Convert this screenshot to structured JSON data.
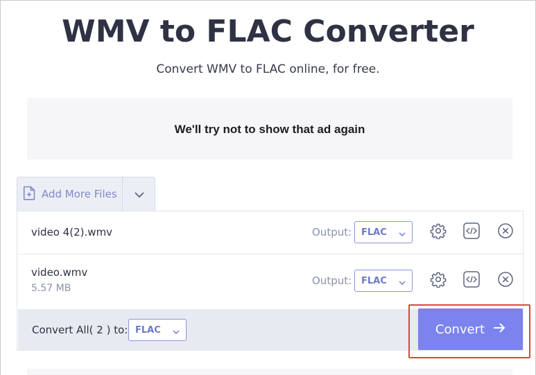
{
  "page": {
    "title": "WMV to FLAC Converter",
    "subtitle": "Convert WMV to FLAC online, for free."
  },
  "ad": {
    "text": "We'll try not to show that ad again"
  },
  "uploader": {
    "add_label": "Add More Files"
  },
  "files": [
    {
      "name": "video 4(2).wmv",
      "size": "",
      "output_label": "Output:",
      "format": "FLAC"
    },
    {
      "name": "video.wmv",
      "size": "5.57 MB",
      "output_label": "Output:",
      "format": "FLAC"
    }
  ],
  "footer": {
    "convert_all_label": "Convert All( 2 ) to:",
    "convert_all_format": "FLAC",
    "convert_label": "Convert"
  },
  "colors": {
    "accent": "#7b83ee",
    "highlight": "#e0453c",
    "select_border": "#8a93d9"
  }
}
